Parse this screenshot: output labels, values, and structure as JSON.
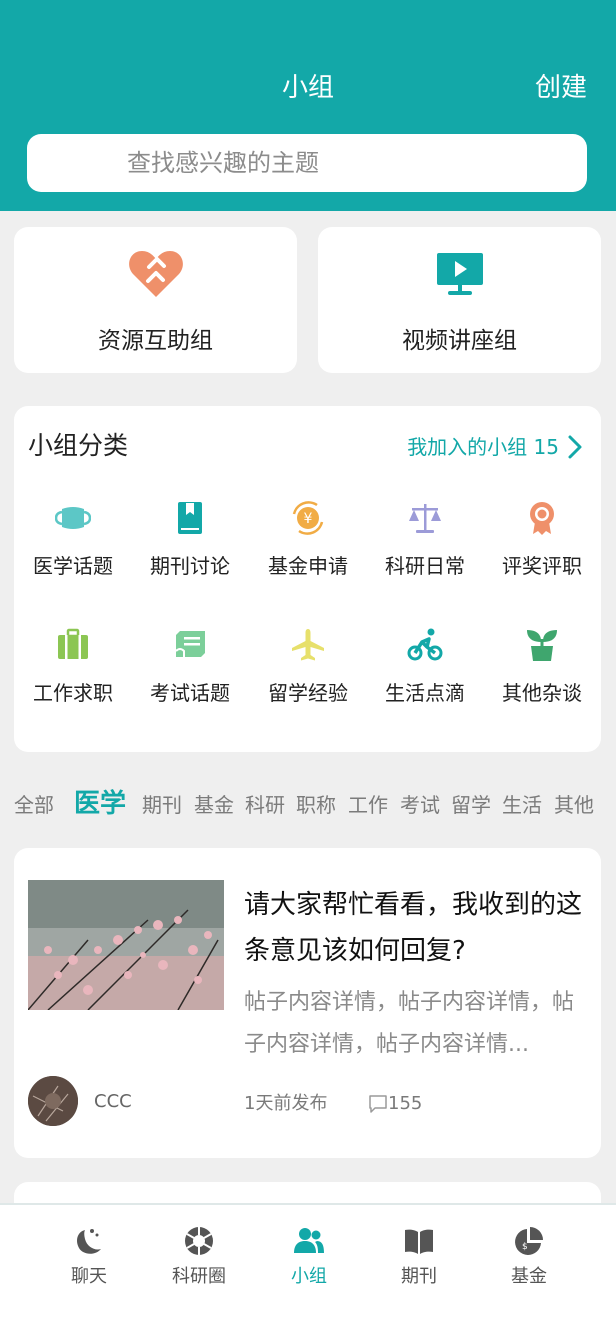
{
  "header": {
    "title": "小组",
    "create_label": "创建"
  },
  "search": {
    "placeholder": "查找感兴趣的主题"
  },
  "quick_groups": [
    {
      "label": "资源互助组",
      "icon": "heart-handshake-icon",
      "color": "#ef906a"
    },
    {
      "label": "视频讲座组",
      "icon": "video-monitor-icon",
      "color": "#13a8a8"
    }
  ],
  "categories": {
    "title": "小组分类",
    "joined_link": "我加入的小组 15",
    "items": [
      {
        "label": "医学话题",
        "icon": "medical-mask-icon",
        "color": "#5cc7c6"
      },
      {
        "label": "期刊讨论",
        "icon": "journal-book-icon",
        "color": "#13a8a8"
      },
      {
        "label": "基金申请",
        "icon": "yuan-coin-icon",
        "color": "#f1ac45"
      },
      {
        "label": "科研日常",
        "icon": "balance-scale-icon",
        "color": "#9c9bd8"
      },
      {
        "label": "评奖评职",
        "icon": "award-medal-icon",
        "color": "#ef906a"
      },
      {
        "label": "工作求职",
        "icon": "briefcase-icon",
        "color": "#8cc653"
      },
      {
        "label": "考试话题",
        "icon": "exam-scroll-icon",
        "color": "#7ccf9a"
      },
      {
        "label": "留学经验",
        "icon": "airplane-icon",
        "color": "#e7e06b"
      },
      {
        "label": "生活点滴",
        "icon": "cycling-icon",
        "color": "#13a8a8"
      },
      {
        "label": "其他杂谈",
        "icon": "plant-sprout-icon",
        "color": "#3fa66e"
      }
    ]
  },
  "filters": {
    "items": [
      "全部",
      "医学",
      "期刊",
      "基金",
      "科研",
      "职称",
      "工作",
      "考试",
      "留学",
      "生活",
      "其他"
    ],
    "active": "医学"
  },
  "post": {
    "title": "请大家帮忙看看，我收到的这条意见该如何回复?",
    "body": "帖子内容详情，帖子内容详情，帖子内容详情，帖子内容详情...",
    "author": "CCC",
    "time": "1天前发布",
    "comments": "155"
  },
  "tabbar": {
    "items": [
      {
        "label": "聊天",
        "icon": "chat-moon-icon"
      },
      {
        "label": "科研圈",
        "icon": "research-circle-icon"
      },
      {
        "label": "小组",
        "icon": "group-people-icon"
      },
      {
        "label": "期刊",
        "icon": "open-book-icon"
      },
      {
        "label": "基金",
        "icon": "fund-pie-icon"
      }
    ],
    "active": "小组"
  },
  "colors": {
    "primary": "#13a8a8",
    "background": "#efefef",
    "card": "#ffffff"
  }
}
